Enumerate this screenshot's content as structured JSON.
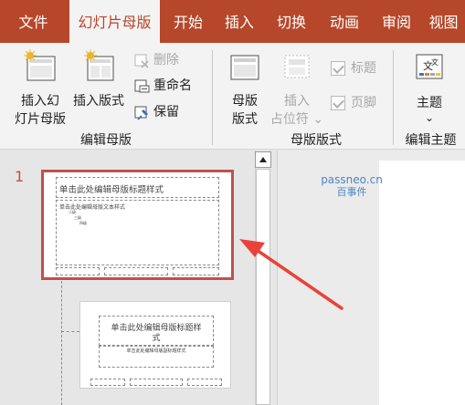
{
  "tabs": [
    {
      "label": "文件",
      "active": false
    },
    {
      "label": "幻灯片母版",
      "active": true
    },
    {
      "label": "开始",
      "active": false
    },
    {
      "label": "插入",
      "active": false
    },
    {
      "label": "切换",
      "active": false
    },
    {
      "label": "动画",
      "active": false
    },
    {
      "label": "审阅",
      "active": false
    },
    {
      "label": "视图",
      "active": false
    }
  ],
  "ribbon": {
    "edit_master": {
      "insert_master_line1": "插入幻",
      "insert_master_line2": "灯片母版",
      "insert_layout": "插入版式",
      "delete": "删除",
      "rename": "重命名",
      "preserve": "保留",
      "group_label": "编辑母版"
    },
    "master_layout": {
      "master_layout_line1": "母版",
      "master_layout_line2": "版式",
      "insert_placeholder_line1": "插入",
      "insert_placeholder_line2": "占位符",
      "title_check": "标题",
      "footer_check": "页脚",
      "group_label": "母版版式"
    },
    "edit_theme": {
      "themes": "主题",
      "group_label": "编辑主题"
    }
  },
  "thumbnails": {
    "slide_number": "1",
    "master_title": "单击此处编辑母版标题样式",
    "master_body": "单击此处编辑母版文本样式",
    "level2": "二级",
    "level3": "三级",
    "level4": "四级",
    "layout_title_line1": "单击此处编辑母版标题样",
    "layout_title_line2": "式",
    "layout_subtitle": "单击此处编辑母版副标题样式"
  },
  "watermark": {
    "line1": "passneo.cn",
    "line2": "百事件"
  },
  "colors": {
    "ribbon_tab_bar": "#b7472a",
    "selection_border": "#c0504d",
    "annotation_arrow": "#e8433a"
  }
}
